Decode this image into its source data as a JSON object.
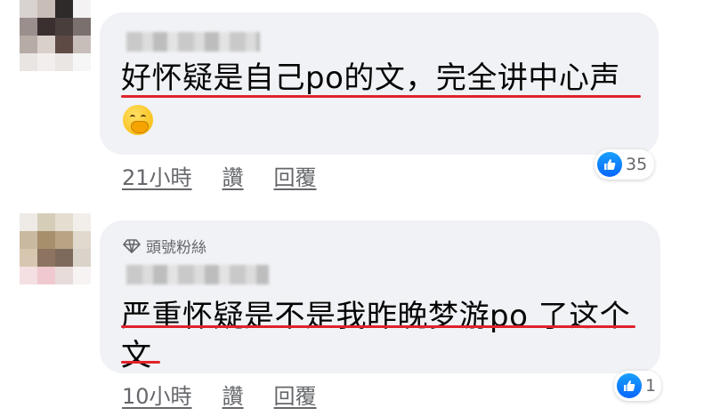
{
  "comments": [
    {
      "text": "好怀疑是自己po的文，完全讲中心声",
      "has_emoji": true,
      "emoji_name": "face-with-hand-over-mouth-icon",
      "time": "21小時",
      "like_label": "讚",
      "reply_label": "回覆",
      "reaction_count": "35"
    },
    {
      "badge": "頭號粉絲",
      "text": "严重怀疑是不是我昨晚梦游po 了这个文",
      "time": "10小時",
      "like_label": "讚",
      "reply_label": "回覆",
      "reaction_count": "1"
    }
  ],
  "colors": {
    "bubble": "#f0f2f5",
    "underline": "#e0232b",
    "meta_text": "#65676b",
    "like_blue": "#0866ff"
  }
}
